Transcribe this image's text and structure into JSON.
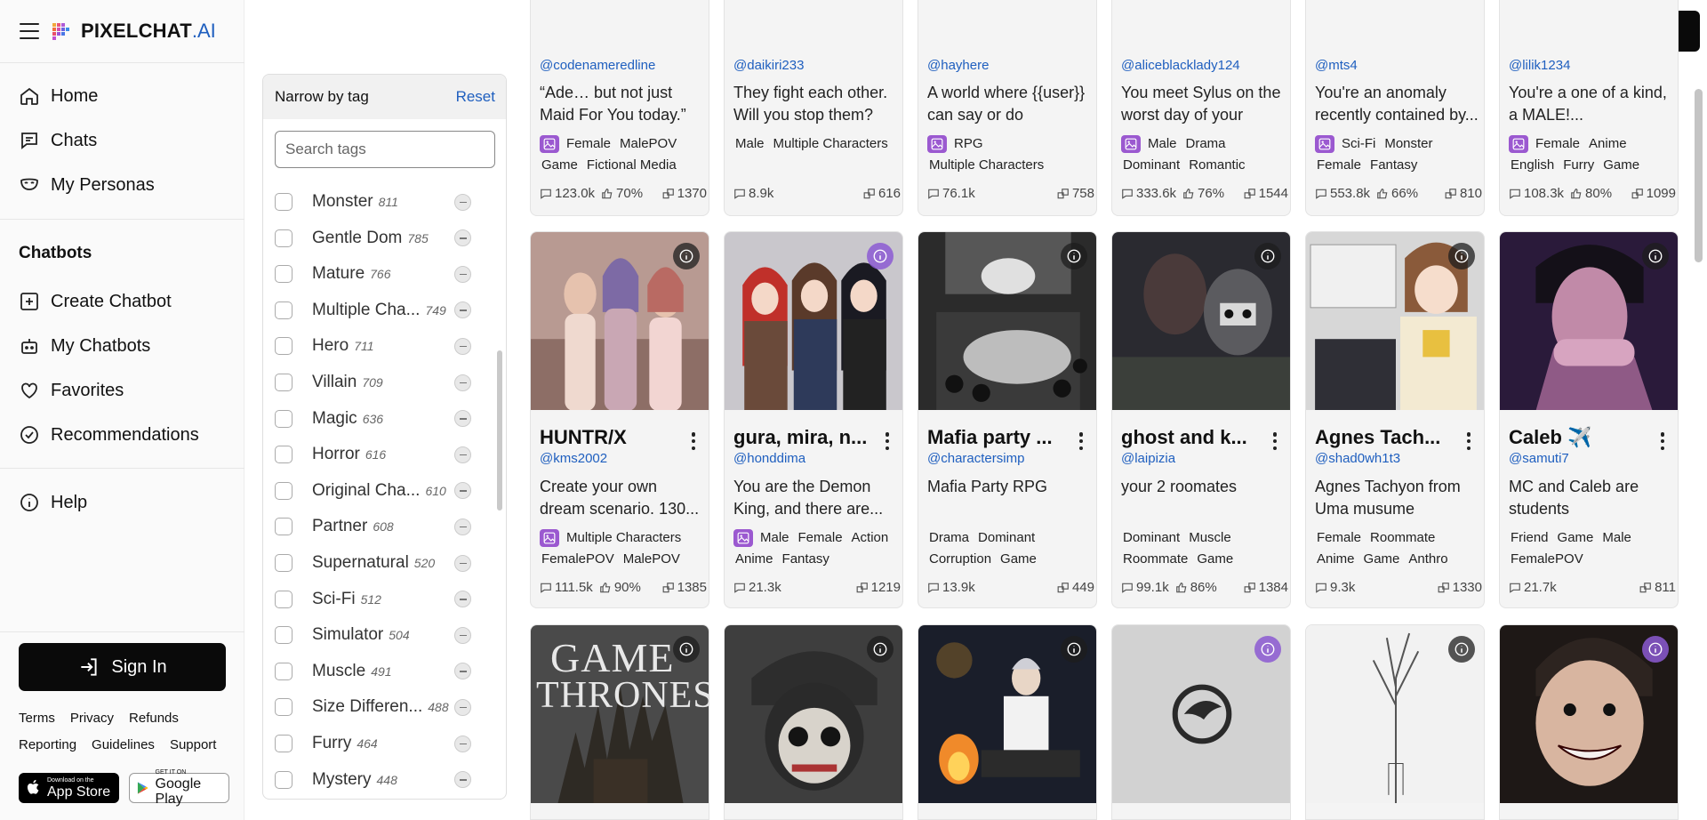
{
  "brand": {
    "name": "PIXELCHAT",
    "suffix": ".AI"
  },
  "nav": {
    "home": "Home",
    "chats": "Chats",
    "personas": "My Personas",
    "section": "Chatbots",
    "create": "Create Chatbot",
    "my_chatbots": "My Chatbots",
    "favorites": "Favorites",
    "recommendations": "Recommendations",
    "help": "Help"
  },
  "sign_in_label": "Sign In",
  "footer": {
    "links_row1": [
      "Terms",
      "Privacy",
      "Refunds"
    ],
    "links_row2": [
      "Reporting",
      "Guidelines",
      "Support"
    ],
    "app_store": {
      "small": "Download on the",
      "big": "App Store"
    },
    "google_play": {
      "small": "GET IT ON",
      "big": "Google Play"
    }
  },
  "tag_panel": {
    "title": "Narrow by tag",
    "reset": "Reset",
    "search_placeholder": "Search tags",
    "tags": [
      {
        "name": "Monster",
        "count": "811"
      },
      {
        "name": "Gentle Dom",
        "count": "785"
      },
      {
        "name": "Mature",
        "count": "766"
      },
      {
        "name": "Multiple Cha...",
        "count": "749"
      },
      {
        "name": "Hero",
        "count": "711"
      },
      {
        "name": "Villain",
        "count": "709"
      },
      {
        "name": "Magic",
        "count": "636"
      },
      {
        "name": "Horror",
        "count": "616"
      },
      {
        "name": "Original Cha...",
        "count": "610"
      },
      {
        "name": "Partner",
        "count": "608"
      },
      {
        "name": "Supernatural",
        "count": "520"
      },
      {
        "name": "Sci-Fi",
        "count": "512"
      },
      {
        "name": "Simulator",
        "count": "504"
      },
      {
        "name": "Muscle",
        "count": "491"
      },
      {
        "name": "Size Differen...",
        "count": "488"
      },
      {
        "name": "Furry",
        "count": "464"
      },
      {
        "name": "Mystery",
        "count": "448"
      }
    ]
  },
  "row_top": [
    {
      "author": "@codenameredline",
      "desc": "“Ade… but not just Maid For You today.”",
      "image_tag": true,
      "tags": [
        "Female",
        "MalePOV",
        "Game",
        "Fictional Media"
      ],
      "chats": "123.0k",
      "likes": "70%",
      "tokens": "1370"
    },
    {
      "author": "@daikiri233",
      "desc": "They fight each other. Will you stop them?",
      "image_tag": false,
      "tags": [
        "Male",
        "Multiple Characters"
      ],
      "chats": "8.9k",
      "likes": "",
      "tokens": "616"
    },
    {
      "author": "@hayhere",
      "desc": "A world where {{user}} can say or do anythin...",
      "image_tag": true,
      "tags": [
        "RPG",
        "Multiple Characters"
      ],
      "chats": "76.1k",
      "likes": "",
      "tokens": "758"
    },
    {
      "author": "@aliceblacklady124",
      "desc": "You meet Sylus on the worst day of your life....",
      "image_tag": true,
      "tags": [
        "Male",
        "Drama",
        "Dominant",
        "Romantic"
      ],
      "chats": "333.6k",
      "likes": "76%",
      "tokens": "1544"
    },
    {
      "author": "@mts4",
      "desc": "You're an anomaly recently contained by...",
      "image_tag": true,
      "tags": [
        "Sci-Fi",
        "Monster",
        "Female",
        "Fantasy"
      ],
      "chats": "553.8k",
      "likes": "66%",
      "tokens": "810"
    },
    {
      "author": "@lilik1234",
      "desc": "You're a one of a kind, a MALE!...",
      "image_tag": true,
      "tags": [
        "Female",
        "Anime",
        "English",
        "Furry",
        "Game"
      ],
      "chats": "108.3k",
      "likes": "80%",
      "tokens": "1099"
    }
  ],
  "row_mid": [
    {
      "title": "HUNTR/X",
      "author": "@kms2002",
      "desc": "Create your own dream scenario. 130...",
      "image_tag": true,
      "tags": [
        "Multiple Characters",
        "FemalePOV",
        "MalePOV"
      ],
      "chats": "111.5k",
      "likes": "90%",
      "tokens": "1385",
      "img": "huntrx",
      "info_purple": false
    },
    {
      "title": "gura, mira, n...",
      "author": "@honddima",
      "desc": "You are the Demon King, and there are...",
      "image_tag": true,
      "tags": [
        "Male",
        "Female",
        "Action",
        "Anime",
        "Fantasy"
      ],
      "chats": "21.3k",
      "likes": "",
      "tokens": "1219",
      "img": "gura",
      "info_purple": true
    },
    {
      "title": "Mafia party ...",
      "author": "@charactersimp",
      "desc": "Mafia Party RPG",
      "image_tag": false,
      "tags": [
        "Drama",
        "Dominant",
        "Corruption",
        "Game"
      ],
      "chats": "13.9k",
      "likes": "",
      "tokens": "449",
      "img": "mafia",
      "info_purple": false
    },
    {
      "title": "ghost and k...",
      "author": "@laipizia",
      "desc": "your 2 roomates",
      "image_tag": false,
      "tags": [
        "Dominant",
        "Muscle",
        "Roommate",
        "Game"
      ],
      "chats": "99.1k",
      "likes": "86%",
      "tokens": "1384",
      "img": "ghost",
      "info_purple": false
    },
    {
      "title": "Agnes Tach...",
      "author": "@shad0wh1t3",
      "desc": "Agnes Tachyon from Uma musume",
      "image_tag": false,
      "tags": [
        "Female",
        "Roommate",
        "Anime",
        "Game",
        "Anthro"
      ],
      "chats": "9.3k",
      "likes": "",
      "tokens": "1330",
      "img": "agnes",
      "info_purple": false
    },
    {
      "title": "Caleb ✈️",
      "author": "@samuti7",
      "desc": "MC and Caleb are students",
      "image_tag": false,
      "tags": [
        "Friend",
        "Game",
        "Male",
        "FemalePOV"
      ],
      "chats": "21.7k",
      "likes": "",
      "tokens": "811",
      "img": "caleb",
      "info_purple": false
    }
  ],
  "row_bottom": [
    {
      "img": "got",
      "logo_text_1": "GAME",
      "logo_text_2": "THRONES",
      "info_purple": false
    },
    {
      "img": "skull",
      "info_purple": false
    },
    {
      "img": "campfire",
      "info_purple": false
    },
    {
      "img": "mockingjay",
      "info_purple": true
    },
    {
      "img": "tree",
      "info_purple": false
    },
    {
      "img": "smile",
      "info_purple": true
    }
  ],
  "icons": {
    "hamburger": "hamburger-icon",
    "home": "home-icon",
    "chats": "chat-icon",
    "personas": "mask-icon",
    "create": "plus-square-icon",
    "bot": "robot-icon",
    "heart": "heart-icon",
    "check": "check-badge-icon",
    "help": "info-icon",
    "theme": "sun-icon",
    "signin": "sign-in-icon"
  },
  "colors": {
    "accent": "#1f5fbf",
    "badge_purple": "#9b59d0",
    "button_dark": "#0a0a0a"
  }
}
